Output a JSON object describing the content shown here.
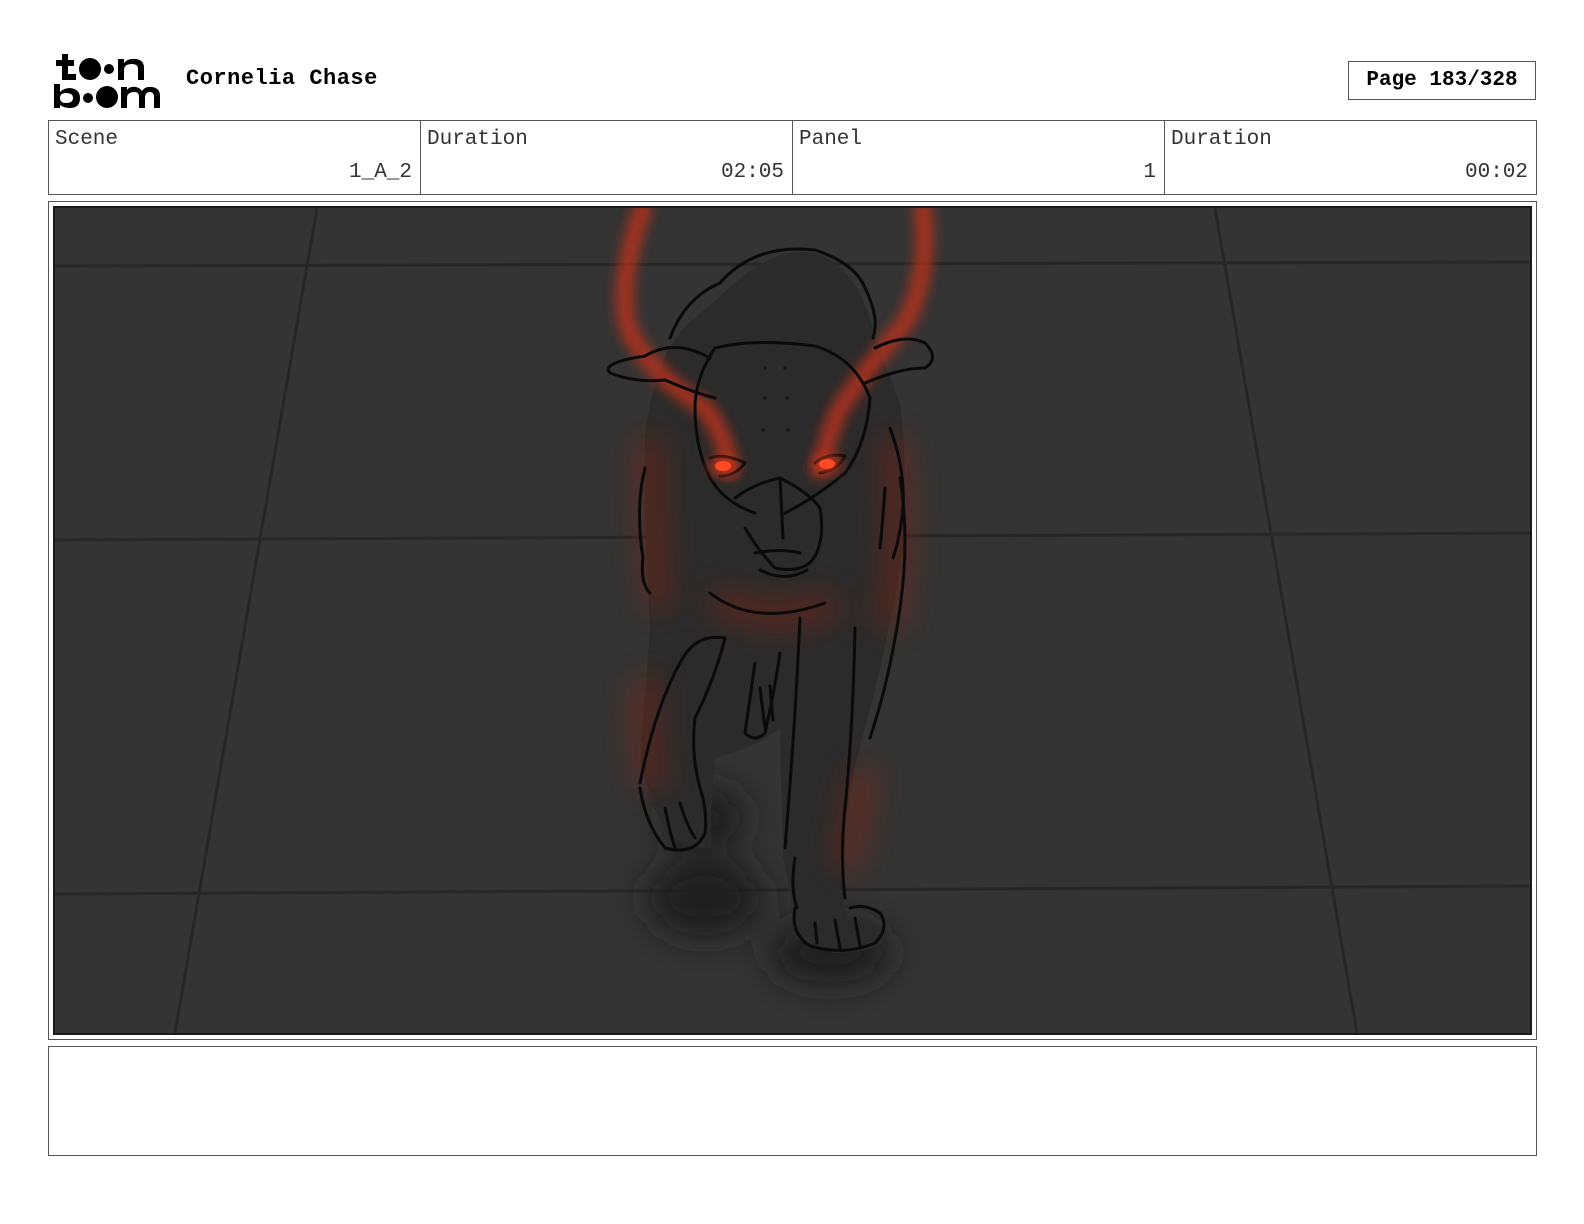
{
  "header": {
    "logo_text": "toon boom",
    "project_title": "Cornelia Chase",
    "page_indicator": "Page 183/328"
  },
  "info": {
    "scene_label": "Scene",
    "scene_value": "1_A_2",
    "scene_duration_label": "Duration",
    "scene_duration_value": "02:05",
    "panel_label": "Panel",
    "panel_value": "1",
    "panel_duration_label": "Duration",
    "panel_duration_value": "00:02"
  },
  "panel": {
    "illustration": "dark-creature-sketch",
    "colors": {
      "background": "#343434",
      "floor_lines": "#252525",
      "glow": "#c8321a",
      "eyes": "#ff3a1a"
    }
  },
  "notes": {
    "text": ""
  }
}
